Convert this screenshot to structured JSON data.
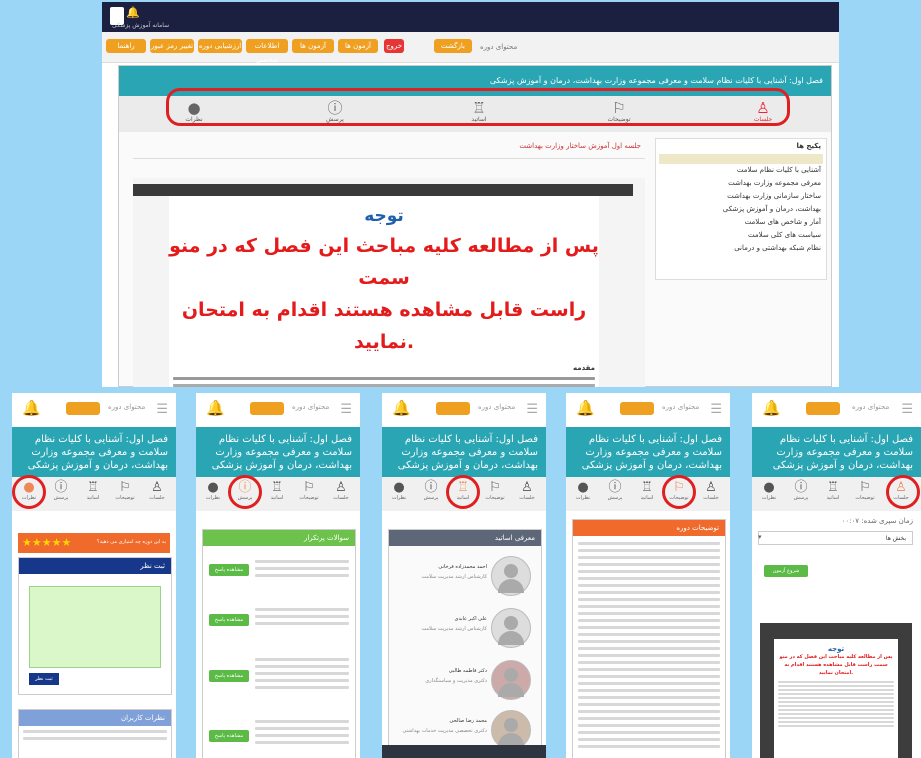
{
  "desktop": {
    "header_title": "سامانه آموزش پزشکی",
    "nav_buttons": [
      "راهنما",
      "تغییر رمز عبور",
      "ارزشیابی دوره",
      "اطلاعات شخصی",
      "آزمون ها",
      "خروج"
    ],
    "course_label": "محتوای دوره",
    "course_button": "بازگشت",
    "course_title": "فصل اول: آشنایی با کلیات نظام سلامت و معرفی مجموعه وزارت بهداشت، درمان و آموزش پزشکی",
    "tabs": [
      {
        "label": "جلسات",
        "icon": "person-icon"
      },
      {
        "label": "توضیحات",
        "icon": "flag-board-icon"
      },
      {
        "label": "اساتید",
        "icon": "teacher-icon"
      },
      {
        "label": "پرسش",
        "icon": "question-icon"
      },
      {
        "label": "نظرات",
        "icon": "chat-icon"
      }
    ],
    "sidebar_title": "پکیج ها",
    "sidebar_items": [
      "آشنایی با کلیات نظام سلامت",
      "معرفی مجموعه وزارت بهداشت",
      "ساختار سازمانی وزارت بهداشت",
      "بهداشت، درمان و آموزش پزشکی",
      "آمار و شاخص های سلامت",
      "سیاست های کلی سلامت",
      "نظام شبکه بهداشتی و درمانی"
    ],
    "doc_header_note": "جلسه اول آموزش ساختار وزارت بهداشت",
    "notice_title": "توجه",
    "notice_line1": "پس از مطالعه کلیه مباحث این فصل که در منو سمت",
    "notice_line2": "راست قابل مشاهده هستند اقدام به امتحان نمایید.",
    "intro_heading": "مقدمه"
  },
  "mobile": {
    "course_label": "محتوای دوره",
    "course_button": "بازگشت",
    "course_title": "فصل اول: آشنایی با کلیات نظام سلامت و معرفی مجموعه وزارت بهداشت، درمان و آموزش پزشکی",
    "tabs": [
      {
        "label": "نظرات",
        "icon": "chat-icon"
      },
      {
        "label": "پرسش",
        "icon": "question-icon"
      },
      {
        "label": "اساتید",
        "icon": "teacher-icon"
      },
      {
        "label": "توضیحات",
        "icon": "flag-board-icon"
      },
      {
        "label": "جلسات",
        "icon": "person-icon"
      }
    ],
    "screen1": {
      "rating_text": "به این دوره چه امتیازی می دهید؟",
      "rating_stars": "★★★★★",
      "comment_header": "ثبت نظر",
      "submit_label": "ثبت نظر",
      "other_comments": "نظرات کاربران"
    },
    "screen2": {
      "header": "سوالات پرتکرار",
      "answer_label": "مشاهده پاسخ"
    },
    "screen3": {
      "header": "معرفی اساتید",
      "teachers": [
        {
          "name": "احمد محمدزاده فرخانی",
          "role": "کارشناس ارشد مدیریت سلامت"
        },
        {
          "name": "علی اکبر عابدی",
          "role": "کارشناس ارشد مدیریت سلامت"
        },
        {
          "name": "دکتر فاطمه طالبی",
          "role": "دکتری مدیریت و سیاستگذاری"
        },
        {
          "name": "محمد رضا صالحی",
          "role": "دکتری تخصصی مدیریت خدمات بهداشتی"
        }
      ]
    },
    "screen4": {
      "header": "توضیحات دوره"
    },
    "screen5": {
      "time_label": "زمان سپری شده: ۰۰:۰۷",
      "select_label": "بخش ها",
      "start_button": "شروع آزمون",
      "doc_title": "توجه",
      "doc_line": "پس از مطالعه کلیه مباحث این فصل که در منو سمت راست قابل مشاهده هستند اقدام به امتحان نمایید."
    }
  }
}
